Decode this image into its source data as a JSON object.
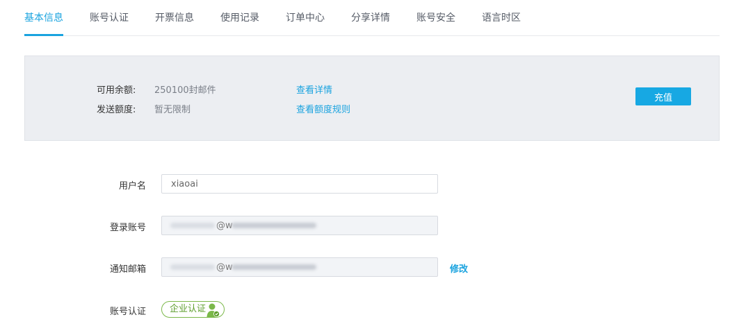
{
  "tabs": [
    {
      "label": "基本信息",
      "active": true
    },
    {
      "label": "账号认证",
      "active": false
    },
    {
      "label": "开票信息",
      "active": false
    },
    {
      "label": "使用记录",
      "active": false
    },
    {
      "label": "订单中心",
      "active": false
    },
    {
      "label": "分享详情",
      "active": false
    },
    {
      "label": "账号安全",
      "active": false
    },
    {
      "label": "语言时区",
      "active": false
    }
  ],
  "balance": {
    "available_label": "可用余额:",
    "available_value": "250100封邮件",
    "available_link": "查看详情",
    "quota_label": "发送额度:",
    "quota_value": "暂无限制",
    "quota_link": "查看额度规则",
    "recharge_label": "充值"
  },
  "form": {
    "username_label": "用户名",
    "username_value": "xiaoai",
    "login_label": "登录账号",
    "login_value_visible": "@w",
    "notify_label": "通知邮箱",
    "notify_value_visible": "@w",
    "modify_label": "修改",
    "cert_label": "账号认证",
    "cert_badge": "企业认证"
  },
  "colors": {
    "accent": "#1aa3df",
    "cert_green": "#5c9d2b"
  },
  "icons": {
    "cert": "verified-user-icon"
  }
}
